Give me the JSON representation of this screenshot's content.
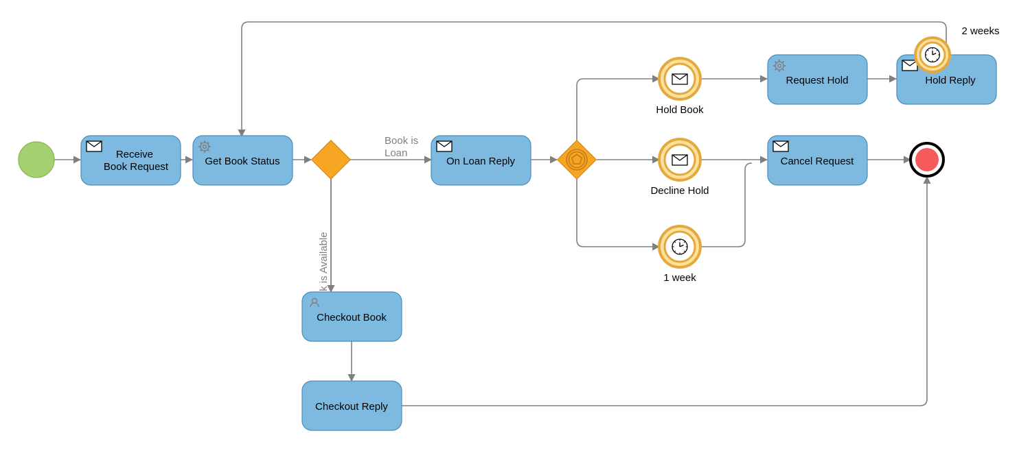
{
  "colors": {
    "task_fill": "#7EBAE0",
    "task_stroke": "#4B8CB8",
    "gateway_fill": "#F6A623",
    "gateway_stroke": "#D9891A",
    "event_thick_fill": "#FDE19B",
    "event_thick_stroke": "#E3A93F",
    "start_fill": "#A5D070",
    "start_stroke": "#8DBE56",
    "end_fill": "#F65A5A",
    "end_stroke": "#000000",
    "event_inner_fill": "#FFFFFF",
    "flow": "#808080"
  },
  "tasks": {
    "receive_book_request": "Receive\nBook Request",
    "get_book_status": "Get Book Status",
    "on_loan_reply": "On Loan Reply",
    "request_hold": "Request Hold",
    "hold_reply": "Hold Reply",
    "cancel_request": "Cancel Request",
    "checkout_book": "Checkout Book",
    "checkout_reply": "Checkout Reply"
  },
  "events": {
    "hold_book": "Hold Book",
    "decline_hold": "Decline Hold",
    "one_week": "1 week",
    "two_weeks": "2 weeks"
  },
  "labels": {
    "book_is_loan": "Book is\nLoan",
    "book_is_available": "Book is Available"
  }
}
